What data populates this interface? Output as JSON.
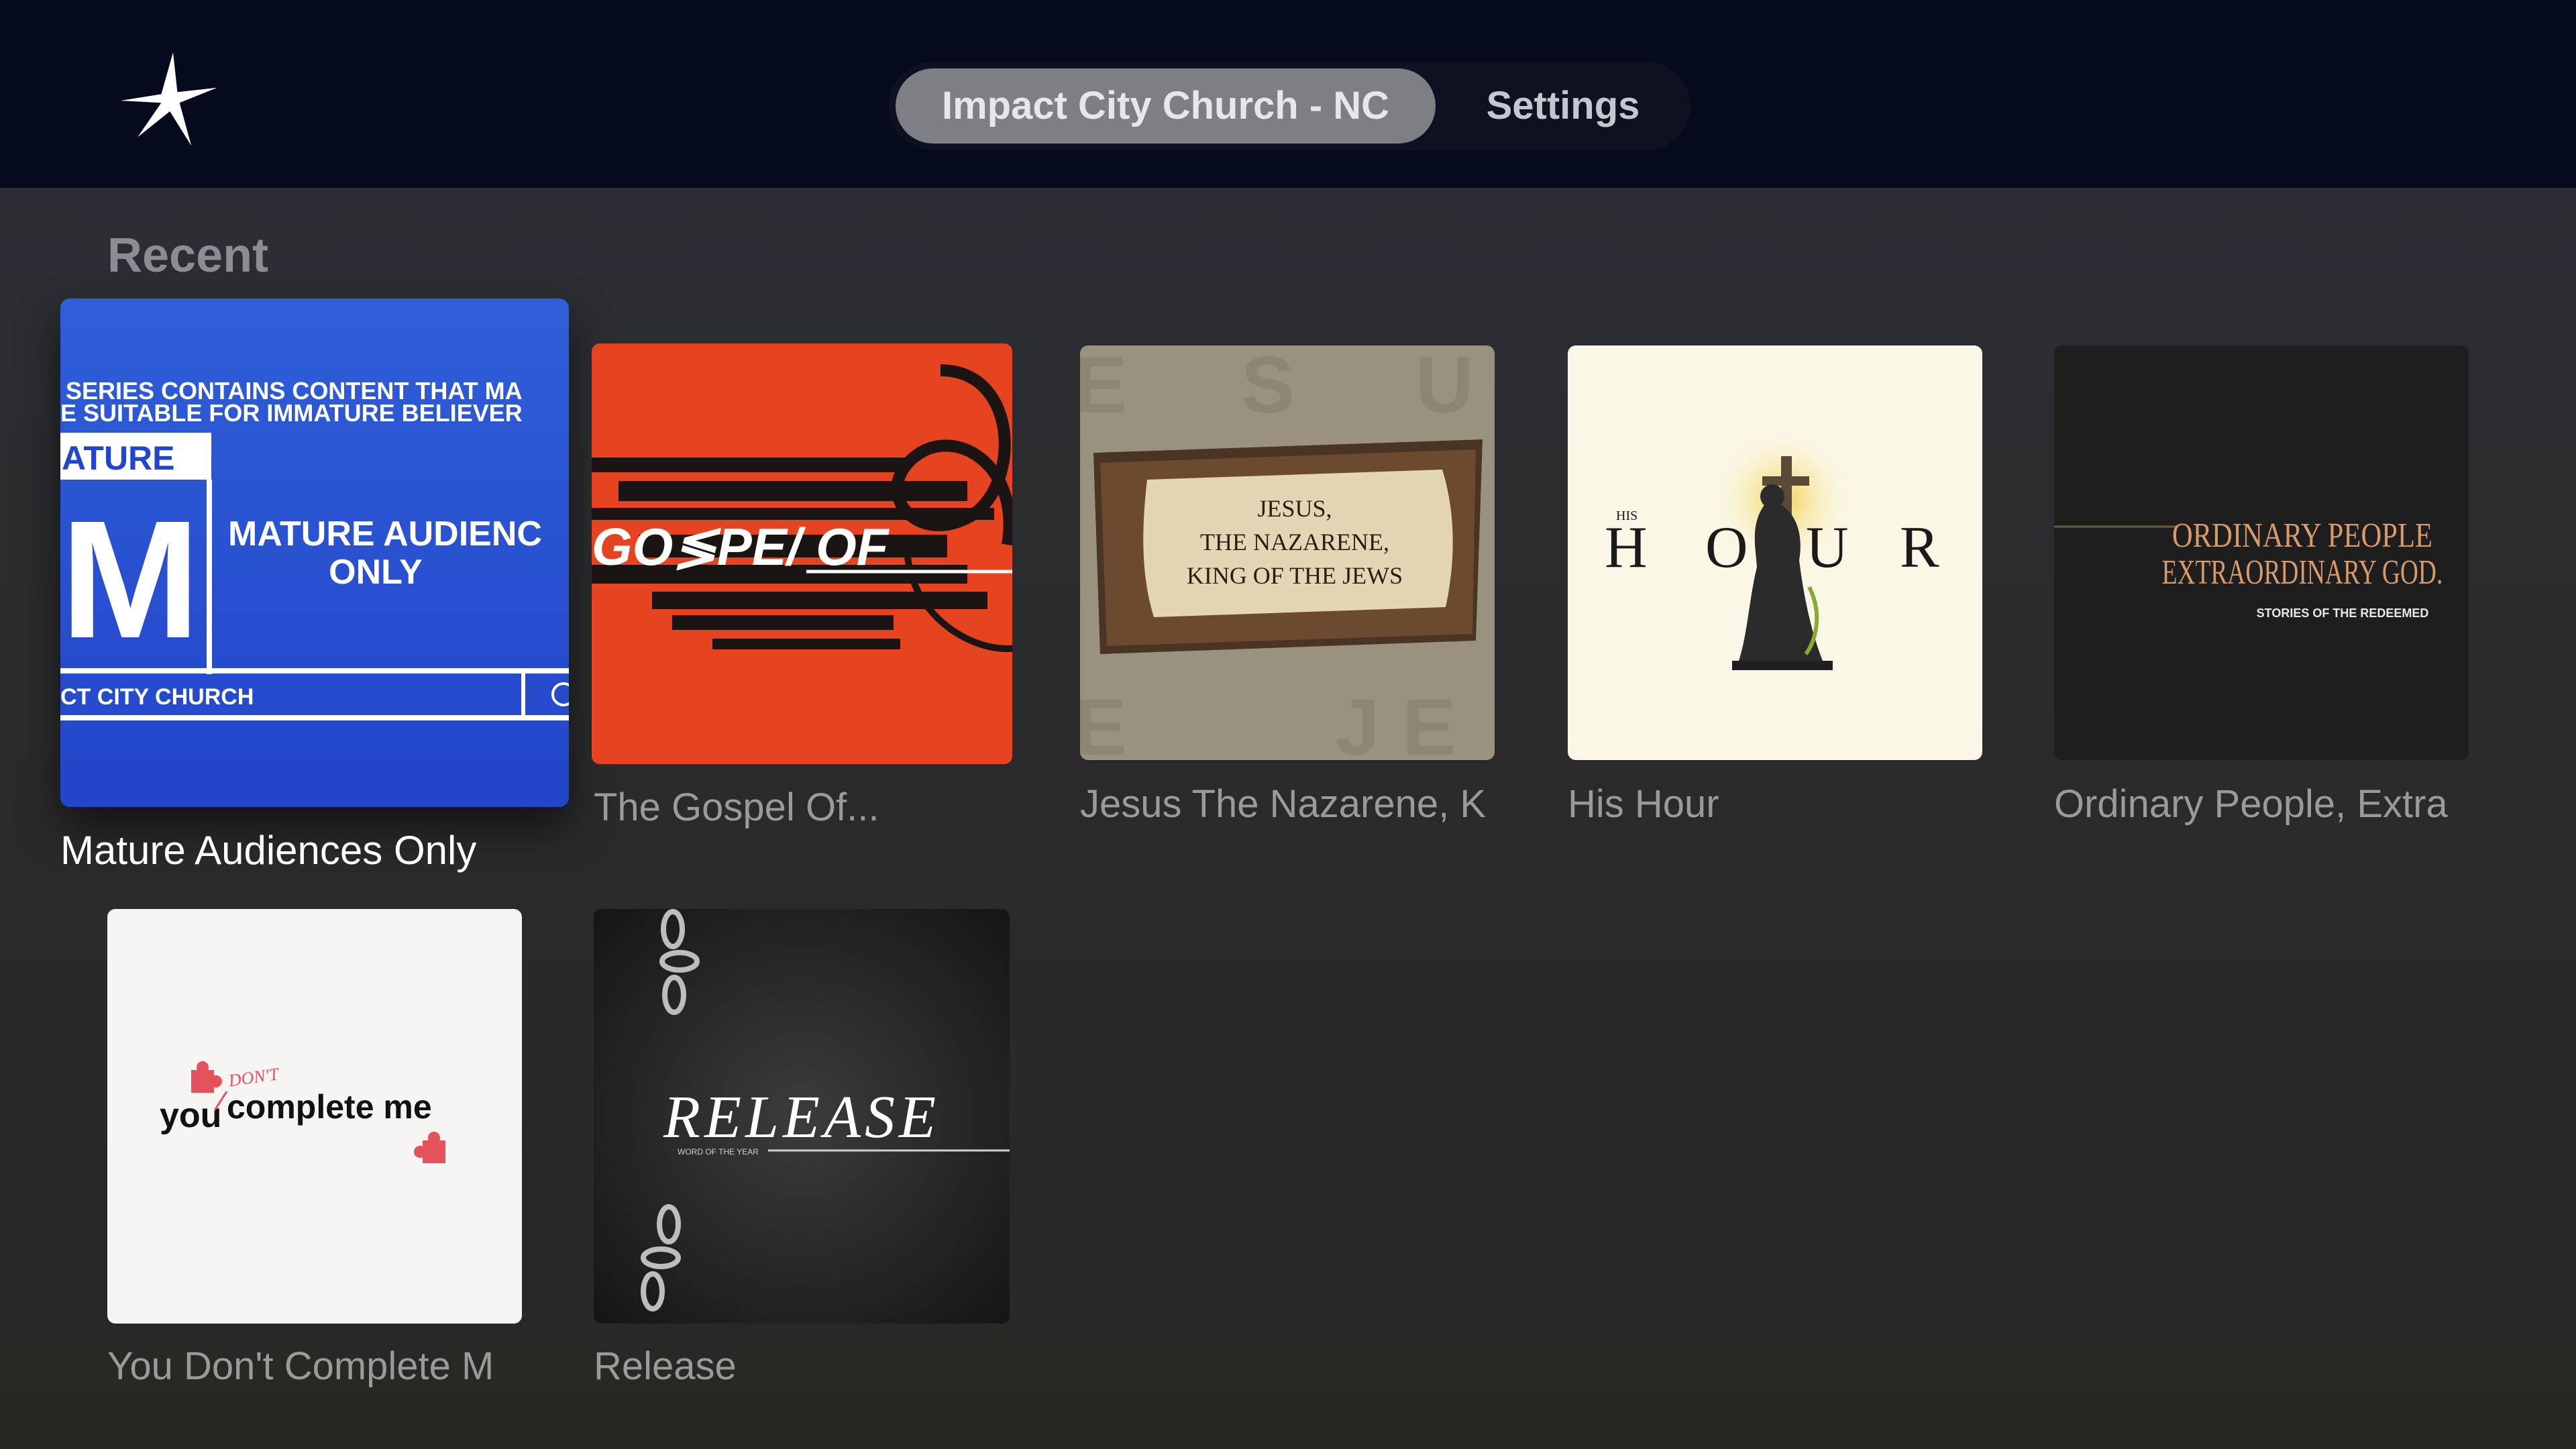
{
  "header": {
    "logo_icon": "star-icon",
    "tabs": [
      {
        "label": "Impact City Church - NC",
        "selected": true
      },
      {
        "label": "Settings",
        "selected": false
      }
    ]
  },
  "section": {
    "title": "Recent"
  },
  "items": [
    {
      "title": "Mature Audiences Only",
      "focused": true,
      "artwork": {
        "line1": "SERIES CONTAINS CONTENT THAT MA",
        "line2": "E SUITABLE FOR IMMATURE BELIEVER",
        "rating_tag": "ATURE",
        "rating_letter": "M",
        "heading1": "MATURE AUDIENC",
        "heading2": "ONLY",
        "footer": "CT CITY CHURCH"
      }
    },
    {
      "title": "The Gospel Of...",
      "artwork": {
        "text": "GO≶PE/ OF"
      }
    },
    {
      "title": "Jesus The Nazarene, K",
      "artwork": {
        "line1": "JESUS,",
        "line2": "THE NAZARENE,",
        "line3": "KING OF THE JEWS"
      }
    },
    {
      "title": "His Hour",
      "artwork": {
        "small": "HIS",
        "letters": [
          "H",
          "O",
          "U",
          "R"
        ]
      }
    },
    {
      "title": "Ordinary People, Extra",
      "artwork": {
        "line1": "ORDINARY PEOPLE",
        "line2": "EXTRAORDINARY GOD.",
        "subtitle": "STORIES OF THE REDEEMED"
      }
    },
    {
      "title": "You Don't Complete M",
      "artwork": {
        "word1": "you",
        "word2": "complete me",
        "insert": "DON'T"
      }
    },
    {
      "title": "Release",
      "artwork": {
        "text": "RELEASE",
        "subtitle": "WORD OF THE YEAR"
      }
    }
  ]
}
